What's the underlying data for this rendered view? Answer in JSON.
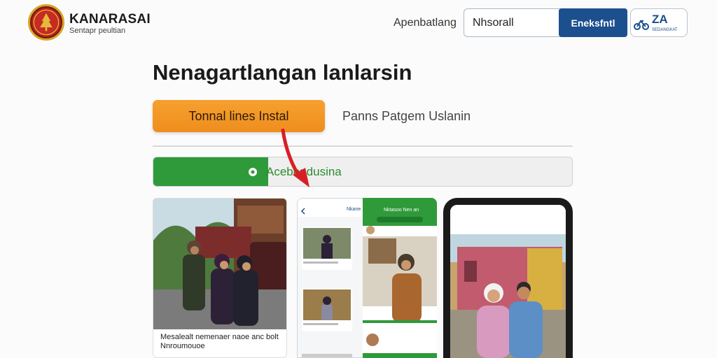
{
  "header": {
    "brand_name": "KANARASAI",
    "brand_subtitle": "Sentapr peultian",
    "nav_link": "Apenbatlang",
    "search_value": "Nhsorall",
    "search_button": "Eneksfntl",
    "partner_logo_text": "ZA",
    "partner_logo_sub": "SEDANGKAT"
  },
  "main": {
    "title": "Nenagartlangan lanlarsin",
    "install_button": "Tonnal lines Instal",
    "secondary_link": "Panns Patgem Uslanin",
    "progress": {
      "label": "Acebondusina",
      "fraction": 0.275
    }
  },
  "cards": [
    {
      "caption_1": "Mesalealt nemenaer naoe anc bolt",
      "caption_2": "Nnroumouoe"
    }
  ],
  "phones": {
    "left_header": "Nkane",
    "middle_header": "Nktasoo Nen an"
  },
  "colors": {
    "primary_blue": "#1c4f8e",
    "install_orange": "#f39a2a",
    "progress_green": "#2f9a3a",
    "arrow_red": "#d81f26"
  }
}
